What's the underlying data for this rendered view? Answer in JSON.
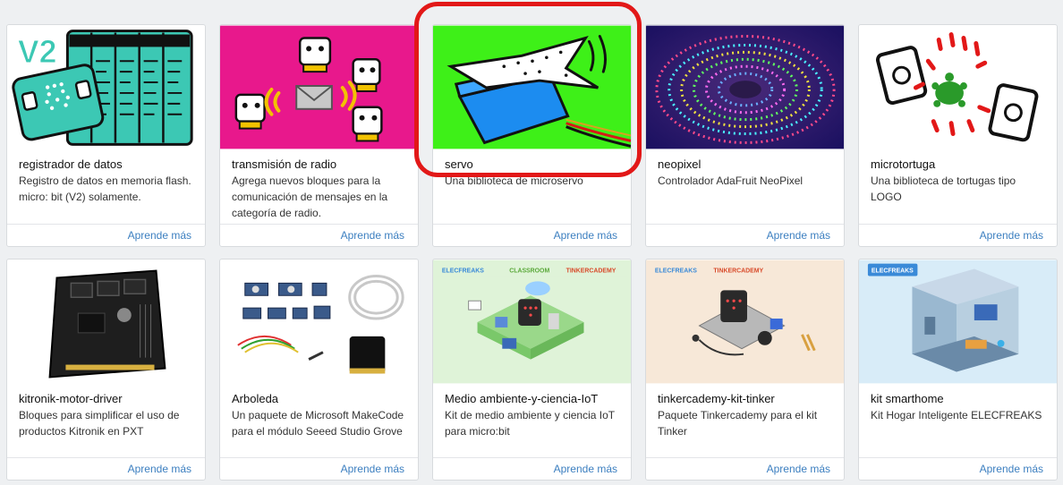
{
  "extensions": [
    {
      "title": "registrador de datos",
      "desc": "Registro de datos en memoria flash. micro: bit (V2) solamente.",
      "link": "Aprende más",
      "badge": "V2"
    },
    {
      "title": "transmisión de radio",
      "desc": "Agrega nuevos bloques para la comunicación de mensajes en la categoría de radio.",
      "link": "Aprende más"
    },
    {
      "title": "servo",
      "desc": "Una biblioteca de microservo",
      "link": "Aprende más"
    },
    {
      "title": "neopixel",
      "desc": "Controlador AdaFruit NeoPixel",
      "link": "Aprende más"
    },
    {
      "title": "microtortuga",
      "desc": "Una biblioteca de tortugas tipo LOGO",
      "link": "Aprende más"
    },
    {
      "title": "kitronik-motor-driver",
      "desc": "Bloques para simplificar el uso de productos Kitronik en PXT",
      "link": "Aprende más"
    },
    {
      "title": "Arboleda",
      "desc": "Un paquete de Microsoft MakeCode para el módulo Seeed Studio Grove",
      "link": "Aprende más"
    },
    {
      "title": "Medio ambiente-y-ciencia-IoT",
      "desc": "Kit de medio ambiente y ciencia IoT para micro:bit",
      "link": "Aprende más",
      "brand": "ELECFREAKS",
      "brand2": "CLASSROOM",
      "brand3": "TINKERCADEMY"
    },
    {
      "title": "tinkercademy-kit-tinker",
      "desc": "Paquete Tinkercademy para el kit Tinker",
      "link": "Aprende más",
      "brand": "ELECFREAKS",
      "brand3": "TINKERCADEMY"
    },
    {
      "title": "kit smarthome",
      "desc": "Kit Hogar Inteligente ELECFREAKS",
      "link": "Aprende más",
      "brand": "ELECFREAKS"
    }
  ],
  "colors": {
    "link": "#3c7fc0",
    "highlight": "#e21818",
    "servo_bg": "#3ef018",
    "radio_bg": "#e8188c",
    "datalogger_bg": "#3cc8b4"
  }
}
